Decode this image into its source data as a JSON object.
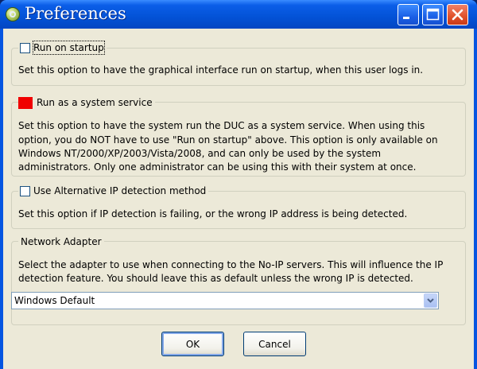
{
  "window": {
    "title": "Preferences",
    "controls": {
      "minimize_icon": "minimize-icon",
      "maximize_icon": "maximize-icon",
      "close_icon": "close-icon"
    },
    "colors": {
      "titlebar": "#0352d6",
      "close": "#e0502a",
      "client": "#ece9d8"
    }
  },
  "startup": {
    "label": "Run on startup",
    "checked": false,
    "description": "Set this option to have the graphical interface run on startup, when this user logs in."
  },
  "service": {
    "label": "Run as a system service",
    "checkbox_color": "#f00000",
    "description_lines": [
      "Set this option to have the system run the DUC as a system service.  When using this",
      "option, you do NOT have to use \"Run on startup\" above.  This option is only available on",
      "Windows NT/2000/XP/2003/Vista/2008, and can only be used by the system",
      "administrators.  Only one administrator can be using this with their system at once."
    ]
  },
  "alt_ip": {
    "label": "Use Alternative IP detection method",
    "checked": false,
    "description": "Set this option if IP detection is failing, or the wrong IP address is being detected."
  },
  "network_adapter": {
    "label": "Network Adapter",
    "description_lines": [
      "Select the adapter to use when connecting to the No-IP servers.  This will influence the IP",
      "detection feature.  You should leave this as default unless the wrong IP is detected."
    ],
    "selected": "Windows Default"
  },
  "buttons": {
    "ok": "OK",
    "cancel": "Cancel"
  }
}
